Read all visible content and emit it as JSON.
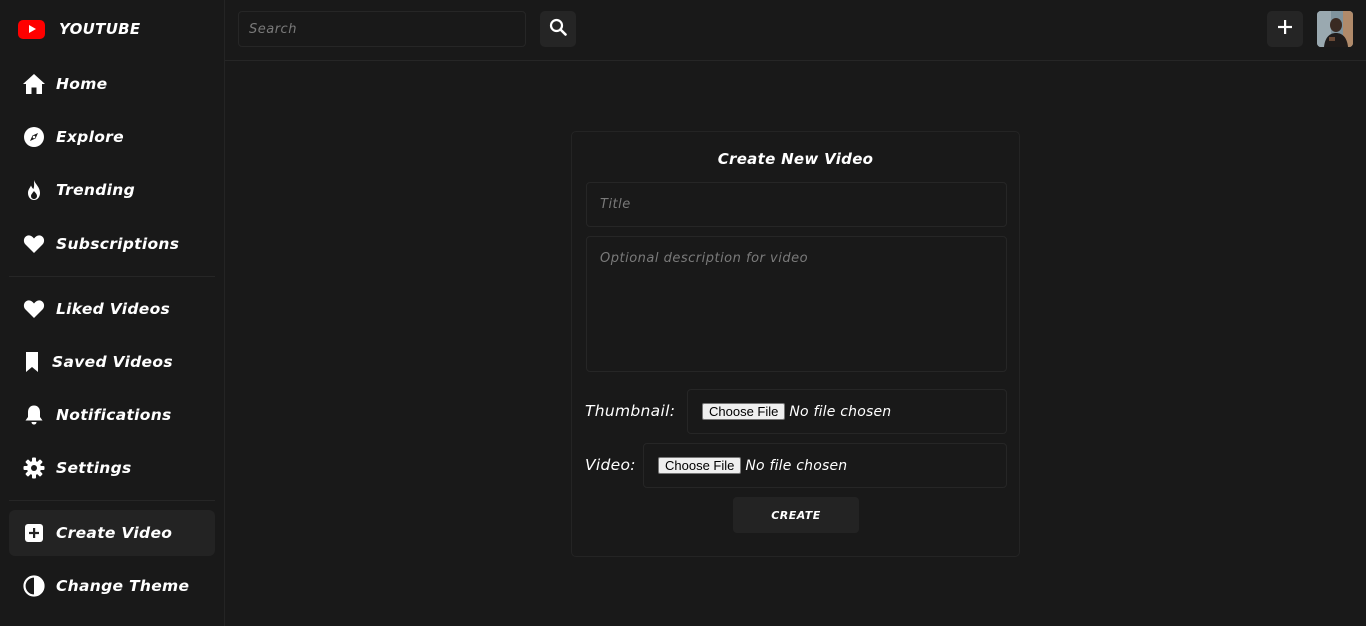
{
  "brand": {
    "name": "YOUTUBE",
    "logo_icon": "youtube-play-icon",
    "logo_color": "#ff0000"
  },
  "sidebar": {
    "primary": [
      {
        "label": "Home",
        "icon": "home-icon"
      },
      {
        "label": "Explore",
        "icon": "compass-icon"
      },
      {
        "label": "Trending",
        "icon": "fire-icon"
      },
      {
        "label": "Subscriptions",
        "icon": "heart-icon"
      }
    ],
    "library": [
      {
        "label": "Liked Videos",
        "icon": "heart-icon"
      },
      {
        "label": "Saved Videos",
        "icon": "bookmark-icon"
      },
      {
        "label": "Notifications",
        "icon": "bell-icon"
      },
      {
        "label": "Settings",
        "icon": "gear-icon"
      }
    ],
    "actions": [
      {
        "label": "Create Video",
        "icon": "plus-square-icon",
        "active": true
      },
      {
        "label": "Change Theme",
        "icon": "half-circle-icon"
      }
    ]
  },
  "topbar": {
    "search_placeholder": "Search",
    "search_icon": "search-icon",
    "create_icon": "plus-icon",
    "avatar_icon": "avatar"
  },
  "form": {
    "heading": "Create New Video",
    "title_placeholder": "Title",
    "description_placeholder": "Optional description for video",
    "thumbnail_label": "Thumbnail:",
    "video_label": "Video:",
    "choose_file_label": "Choose File",
    "no_file_text": "No file chosen",
    "submit_label": "CREATE"
  },
  "colors": {
    "background": "#191919",
    "accent": "#ff0000",
    "text": "#ffffff"
  }
}
